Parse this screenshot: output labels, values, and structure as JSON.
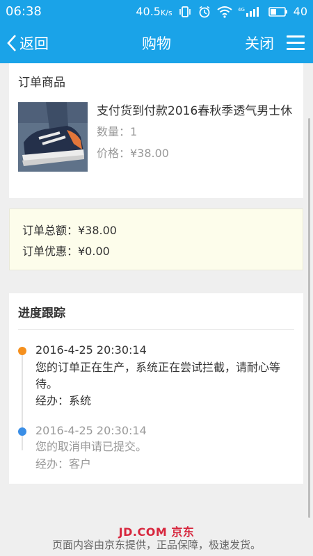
{
  "status_bar": {
    "time": "06:38",
    "net_speed": "40.5",
    "net_unit": "K/s",
    "battery": "40"
  },
  "nav": {
    "back_label": "返回",
    "title": "购物",
    "close_label": "关闭"
  },
  "order_goods": {
    "section_title": "订单商品",
    "product_name": "支付货到付款2016春秋季透气男士休",
    "quantity": "数量：1",
    "price": "价格：¥38.00"
  },
  "totals": {
    "total": "订单总额：¥38.00",
    "discount": "订单优惠：¥0.00"
  },
  "tracking": {
    "title": "进度跟踪",
    "events": [
      {
        "time": "2016-4-25 20:30:14",
        "message": "您的订单正在生产，系统正在尝试拦截，请耐心等待。",
        "operator": "经办：系统",
        "color": "#f5901e"
      },
      {
        "time": "2016-4-25 20:30:14",
        "message": "您的取消申请已提交。",
        "operator": "经办：客户",
        "color": "#3a8ee6"
      }
    ]
  },
  "footer": {
    "logo": "JD.COM 京东",
    "text": "页面内容由京东提供，正品保障，极速发货。"
  },
  "colors": {
    "brand": "#1aa3e8",
    "jd_red": "#d7263d"
  }
}
